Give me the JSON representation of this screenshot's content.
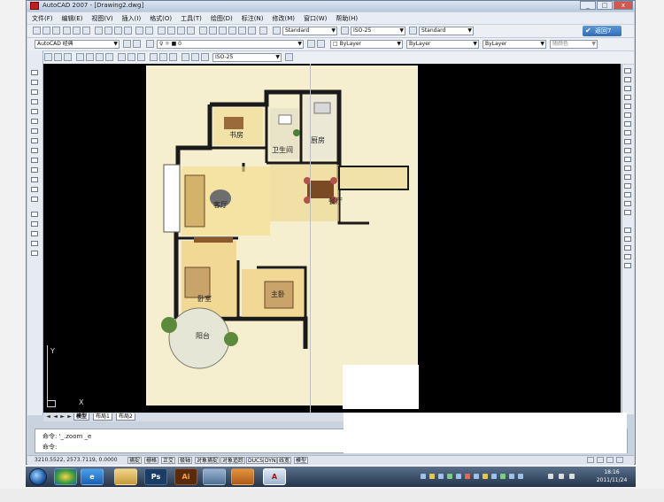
{
  "window": {
    "title": "AutoCAD 2007 - [Drawing2.dwg]",
    "controls": [
      "_",
      "□",
      "x"
    ]
  },
  "menu": {
    "items": [
      "文件(F)",
      "编辑(E)",
      "视图(V)",
      "插入(I)",
      "格式(O)",
      "工具(T)",
      "绘图(D)",
      "标注(N)",
      "修改(M)",
      "窗口(W)",
      "帮助(H)"
    ]
  },
  "toolbar": {
    "text_style": "Standard",
    "dim_style": "ISO-25",
    "table_style": "Standard",
    "return_label": "返回7",
    "workspace": "AutoCAD 经典",
    "layer_value": "0",
    "color_control": "ByLayer",
    "linetype_control": "ByLayer",
    "lineweight_control": "ByLayer",
    "plotstyle_control": "随颜色",
    "dim_style_2": "ISO-25"
  },
  "floor_plan": {
    "rooms": [
      "书房",
      "卫生间",
      "厨房",
      "客厅",
      "餐厅",
      "卧室",
      "主卧",
      "阳台"
    ]
  },
  "ucs": {
    "y_label": "Y",
    "x_label": "X"
  },
  "layout_tabs": {
    "tabs": [
      "模型",
      "布局1",
      "布局2"
    ],
    "active": "模型"
  },
  "command": {
    "line1": "命令:  '_.zoom  _e",
    "line2": "命令:"
  },
  "status": {
    "coords": "3210.5522, 2573.7119, 0.0000",
    "buttons": [
      "捕捉",
      "栅格",
      "正交",
      "极轴",
      "对象捕捉",
      "对象追踪",
      "DUCS",
      "DYN",
      "线宽",
      "模型"
    ]
  },
  "taskbar": {
    "apps": [
      "Firefox",
      "IE",
      "Explorer",
      "Ps",
      "Ai",
      "Window",
      "Home",
      "AutoCAD"
    ],
    "ps_label": "Ps",
    "ai_label": "Ai",
    "clock_time": "18:16",
    "clock_date": "2011/11/24"
  }
}
